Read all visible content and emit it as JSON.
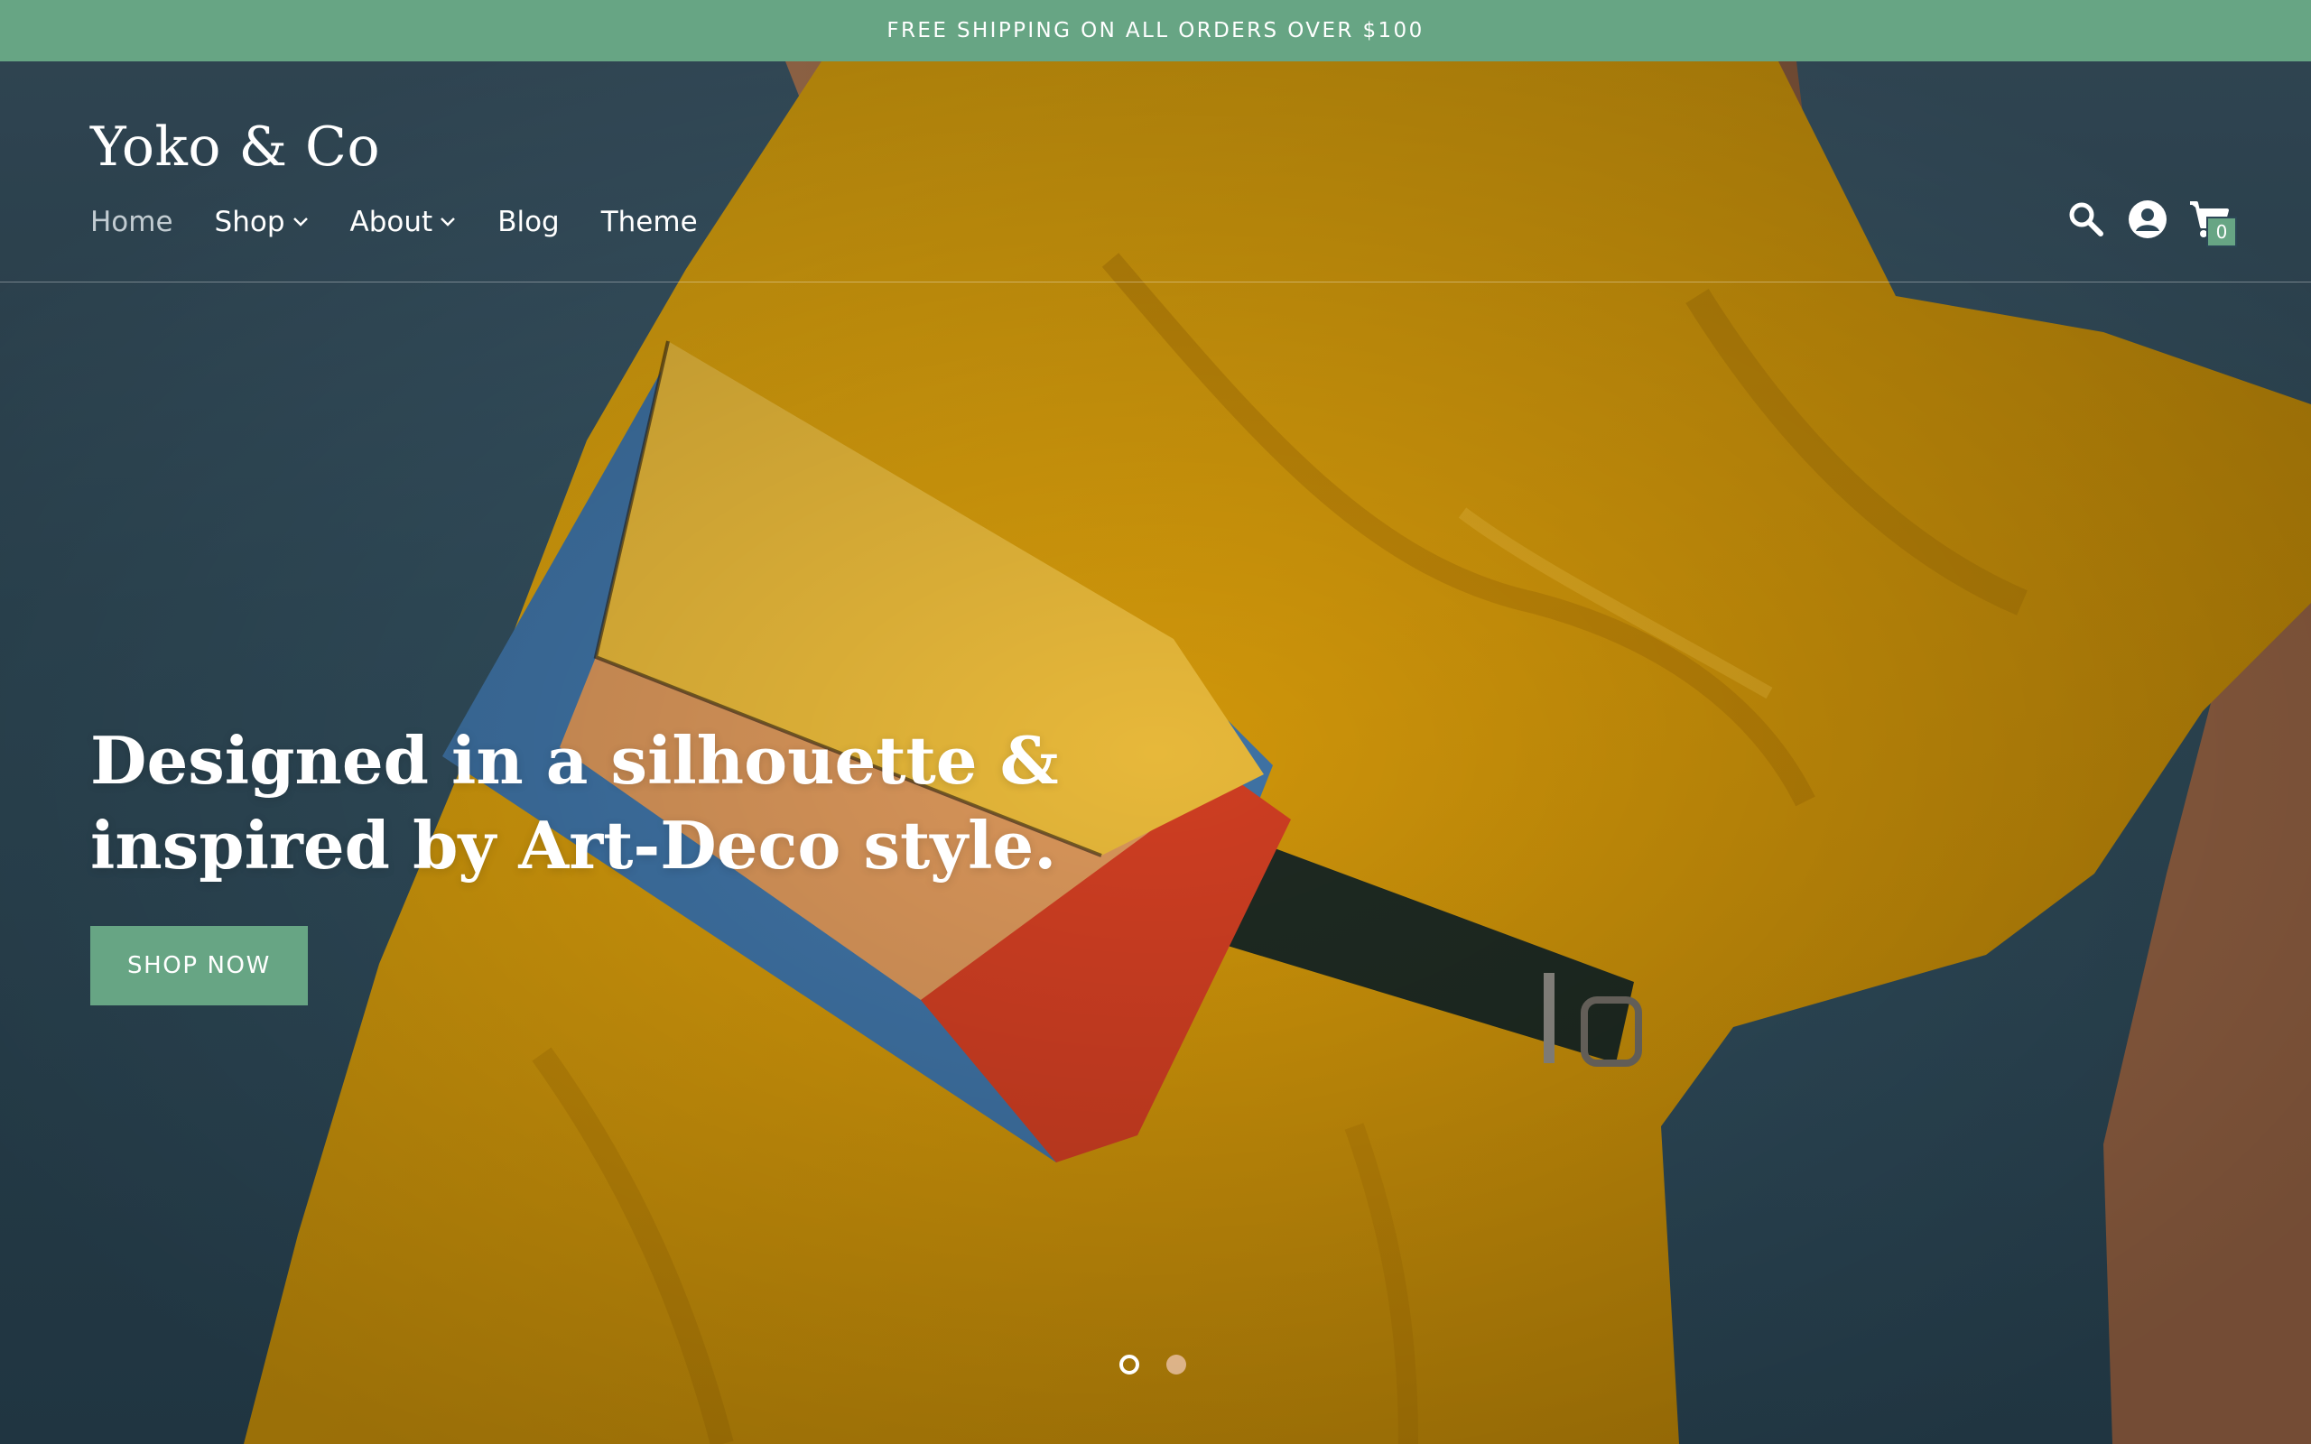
{
  "announcement": {
    "text": "FREE SHIPPING ON ALL ORDERS OVER $100"
  },
  "brand": {
    "name": "Yoko & Co"
  },
  "nav": {
    "items": [
      {
        "label": "Home",
        "active": true,
        "dropdown": false
      },
      {
        "label": "Shop",
        "active": false,
        "dropdown": true
      },
      {
        "label": "About",
        "active": false,
        "dropdown": true
      },
      {
        "label": "Blog",
        "active": false,
        "dropdown": false
      },
      {
        "label": "Theme",
        "active": false,
        "dropdown": false
      }
    ]
  },
  "header_icons": {
    "search": "search-icon",
    "account": "account-icon",
    "cart": "cart-icon",
    "cart_count": "0"
  },
  "hero": {
    "title": "Designed in a silhouette & inspired by Art-Deco style.",
    "cta_label": "SHOP NOW",
    "slides_total": 2,
    "active_slide": 1
  },
  "colors": {
    "accent": "#67a584",
    "hero_background": "#2c4656",
    "dress": "#d69d0c",
    "text_light": "#ffffff"
  }
}
